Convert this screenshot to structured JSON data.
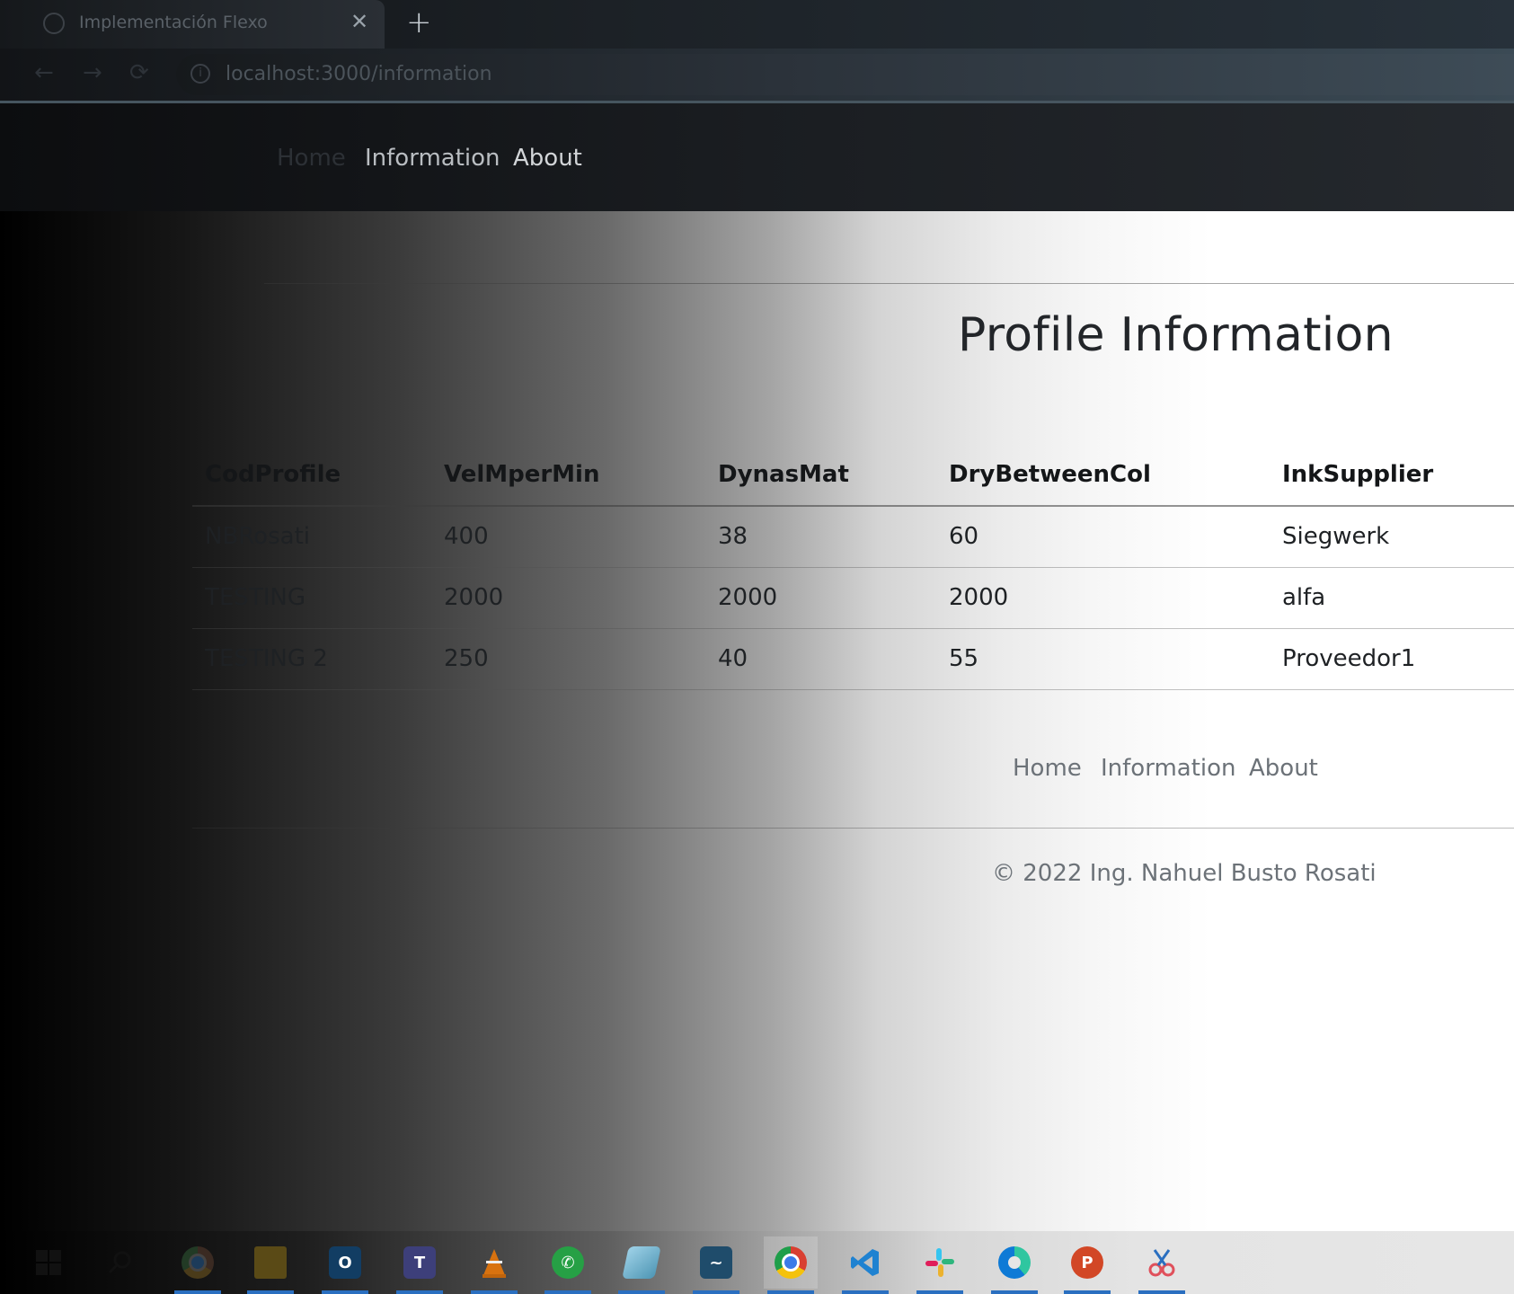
{
  "browser": {
    "tab_title": "Implementación Flexo",
    "tab_close": "✕",
    "new_tab": "+",
    "url": "localhost:3000/information",
    "back": "←",
    "forward": "→",
    "reload": "⟳"
  },
  "navbar": {
    "links": [
      "Home",
      "Information",
      "About"
    ]
  },
  "page": {
    "title": "Profile Information"
  },
  "table": {
    "headers": [
      "CodProfile",
      "VelMperMin",
      "DynasMat",
      "DryBetweenCol",
      "InkSupplier"
    ],
    "rows": [
      [
        "NBRosati",
        "400",
        "38",
        "60",
        "Siegwerk"
      ],
      [
        "TESTING",
        "2000",
        "2000",
        "2000",
        "alfa"
      ],
      [
        "TESTING 2",
        "250",
        "40",
        "55",
        "Proveedor1"
      ]
    ]
  },
  "footer": {
    "links": [
      "Home",
      "Information",
      "About"
    ],
    "copyright": "© 2022 Ing. Nahuel Busto Rosati"
  },
  "taskbar": {
    "items": [
      {
        "icon": "windows-start-icon",
        "label": "Start"
      },
      {
        "icon": "search-icon",
        "label": "Search"
      },
      {
        "icon": "chrome-icon",
        "label": "Chrome"
      },
      {
        "icon": "file-explorer-icon",
        "label": "File Explorer"
      },
      {
        "icon": "outlook-icon",
        "label": "Outlook"
      },
      {
        "icon": "teams-icon",
        "label": "Teams"
      },
      {
        "icon": "vlc-icon",
        "label": "VLC"
      },
      {
        "icon": "whatsapp-icon",
        "label": "WhatsApp"
      },
      {
        "icon": "notepad-icon",
        "label": "Notepad"
      },
      {
        "icon": "mysql-workbench-icon",
        "label": "MySQL Workbench"
      },
      {
        "icon": "chrome-profile-icon",
        "label": "Chrome"
      },
      {
        "icon": "vscode-icon",
        "label": "Visual Studio Code"
      },
      {
        "icon": "slack-icon",
        "label": "Slack"
      },
      {
        "icon": "edge-icon",
        "label": "Edge"
      },
      {
        "icon": "powerpoint-icon",
        "label": "PowerPoint"
      },
      {
        "icon": "snipping-tool-icon",
        "label": "Snipping Tool"
      }
    ]
  },
  "colors": {
    "navbar_bg": "#1a1d21",
    "title_text": "#222529",
    "muted_text": "#6c7278",
    "taskbar_indicator": "#2a6fc0"
  }
}
